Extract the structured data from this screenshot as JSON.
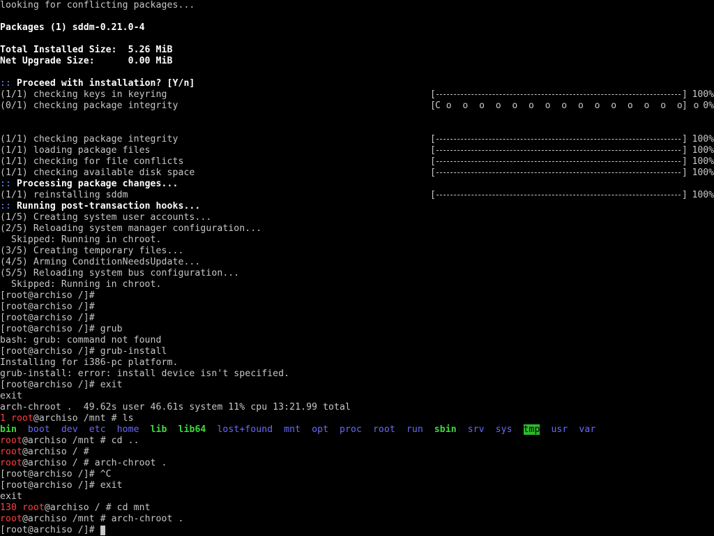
{
  "terminal": {
    "lines": [
      {
        "segments": [
          {
            "text": "looking for conflicting packages...",
            "color": "default"
          }
        ]
      },
      {
        "segments": []
      },
      {
        "segments": [
          {
            "text": "Packages (1) sddm-0.21.0-4",
            "color": "white"
          }
        ]
      },
      {
        "segments": []
      },
      {
        "segments": [
          {
            "text": "Total Installed Size:  5.26 MiB",
            "color": "white"
          }
        ]
      },
      {
        "segments": [
          {
            "text": "Net Upgrade Size:      0.00 MiB",
            "color": "white"
          }
        ]
      },
      {
        "segments": []
      },
      {
        "segments": [
          {
            "text": ":: ",
            "color": "cyan"
          },
          {
            "text": "Proceed with installation? [Y/n]",
            "color": "white"
          }
        ]
      },
      {
        "segments": [
          {
            "text": "(1/1) checking keys in keyring",
            "color": "default"
          }
        ],
        "progress": {
          "percent": 100,
          "percent_label": "100%",
          "style": "dash"
        }
      },
      {
        "segments": [
          {
            "text": "(0/1) checking package integrity",
            "color": "default"
          }
        ],
        "progress": {
          "percent": 0,
          "percent_label": "0%",
          "style": "pacman",
          "pacman_text": "C o  o  o  o  o  o  o  o  o  o  o  o  o  o  o  o"
        }
      },
      {
        "segments": []
      },
      {
        "segments": []
      },
      {
        "segments": [
          {
            "text": "(1/1) checking package integrity",
            "color": "default"
          }
        ],
        "progress": {
          "percent": 100,
          "percent_label": "100%",
          "style": "dash"
        }
      },
      {
        "segments": [
          {
            "text": "(1/1) loading package files",
            "color": "default"
          }
        ],
        "progress": {
          "percent": 100,
          "percent_label": "100%",
          "style": "dash"
        }
      },
      {
        "segments": [
          {
            "text": "(1/1) checking for file conflicts",
            "color": "default"
          }
        ],
        "progress": {
          "percent": 100,
          "percent_label": "100%",
          "style": "dash"
        }
      },
      {
        "segments": [
          {
            "text": "(1/1) checking available disk space",
            "color": "default"
          }
        ],
        "progress": {
          "percent": 100,
          "percent_label": "100%",
          "style": "dash"
        }
      },
      {
        "segments": [
          {
            "text": ":: ",
            "color": "cyan"
          },
          {
            "text": "Processing package changes...",
            "color": "white"
          }
        ]
      },
      {
        "segments": [
          {
            "text": "(1/1) reinstalling sddm",
            "color": "default"
          }
        ],
        "progress": {
          "percent": 100,
          "percent_label": "100%",
          "style": "dash"
        }
      },
      {
        "segments": [
          {
            "text": ":: ",
            "color": "cyan"
          },
          {
            "text": "Running post-transaction hooks...",
            "color": "white"
          }
        ]
      },
      {
        "segments": [
          {
            "text": "(1/5) Creating system user accounts...",
            "color": "default"
          }
        ]
      },
      {
        "segments": [
          {
            "text": "(2/5) Reloading system manager configuration...",
            "color": "default"
          }
        ]
      },
      {
        "segments": [
          {
            "text": "  Skipped: Running in chroot.",
            "color": "default"
          }
        ]
      },
      {
        "segments": [
          {
            "text": "(3/5) Creating temporary files...",
            "color": "default"
          }
        ]
      },
      {
        "segments": [
          {
            "text": "(4/5) Arming ConditionNeedsUpdate...",
            "color": "default"
          }
        ]
      },
      {
        "segments": [
          {
            "text": "(5/5) Reloading system bus configuration...",
            "color": "default"
          }
        ]
      },
      {
        "segments": [
          {
            "text": "  Skipped: Running in chroot.",
            "color": "default"
          }
        ]
      },
      {
        "segments": [
          {
            "text": "[root@archiso /]#",
            "color": "default"
          }
        ]
      },
      {
        "segments": [
          {
            "text": "[root@archiso /]#",
            "color": "default"
          }
        ]
      },
      {
        "segments": [
          {
            "text": "[root@archiso /]#",
            "color": "default"
          }
        ]
      },
      {
        "segments": [
          {
            "text": "[root@archiso /]# grub",
            "color": "default"
          }
        ]
      },
      {
        "segments": [
          {
            "text": "bash: grub: command not found",
            "color": "default"
          }
        ]
      },
      {
        "segments": [
          {
            "text": "[root@archiso /]# grub-install",
            "color": "default"
          }
        ]
      },
      {
        "segments": [
          {
            "text": "Installing for i386-pc platform.",
            "color": "default"
          }
        ]
      },
      {
        "segments": [
          {
            "text": "grub-install: error: install device isn't specified.",
            "color": "default"
          }
        ]
      },
      {
        "segments": [
          {
            "text": "[root@archiso /]# exit",
            "color": "default"
          }
        ]
      },
      {
        "segments": [
          {
            "text": "exit",
            "color": "default"
          }
        ]
      },
      {
        "segments": [
          {
            "text": "arch-chroot .  49.62s user 46.61s system 11% cpu 13:21.99 total",
            "color": "default"
          }
        ]
      },
      {
        "segments": [
          {
            "text": "1 ",
            "color": "red"
          },
          {
            "text": "root",
            "color": "red"
          },
          {
            "text": "@archiso /mnt # ls",
            "color": "default"
          }
        ]
      },
      {
        "segments": [
          {
            "text": "bin",
            "color": "green"
          },
          {
            "text": "  ",
            "color": "default"
          },
          {
            "text": "boot",
            "color": "blue"
          },
          {
            "text": "  ",
            "color": "default"
          },
          {
            "text": "dev",
            "color": "blue"
          },
          {
            "text": "  ",
            "color": "default"
          },
          {
            "text": "etc",
            "color": "blue"
          },
          {
            "text": "  ",
            "color": "default"
          },
          {
            "text": "home",
            "color": "blue"
          },
          {
            "text": "  ",
            "color": "default"
          },
          {
            "text": "lib",
            "color": "green"
          },
          {
            "text": "  ",
            "color": "default"
          },
          {
            "text": "lib64",
            "color": "green"
          },
          {
            "text": "  ",
            "color": "default"
          },
          {
            "text": "lost+found",
            "color": "blue"
          },
          {
            "text": "  ",
            "color": "default"
          },
          {
            "text": "mnt",
            "color": "blue"
          },
          {
            "text": "  ",
            "color": "default"
          },
          {
            "text": "opt",
            "color": "blue"
          },
          {
            "text": "  ",
            "color": "default"
          },
          {
            "text": "proc",
            "color": "blue"
          },
          {
            "text": "  ",
            "color": "default"
          },
          {
            "text": "root",
            "color": "blue"
          },
          {
            "text": "  ",
            "color": "default"
          },
          {
            "text": "run",
            "color": "blue"
          },
          {
            "text": "  ",
            "color": "default"
          },
          {
            "text": "sbin",
            "color": "green"
          },
          {
            "text": "  ",
            "color": "default"
          },
          {
            "text": "srv",
            "color": "blue"
          },
          {
            "text": "  ",
            "color": "default"
          },
          {
            "text": "sys",
            "color": "blue"
          },
          {
            "text": "  ",
            "color": "default"
          },
          {
            "text": "tmp",
            "color": "tmp"
          },
          {
            "text": "  ",
            "color": "default"
          },
          {
            "text": "usr",
            "color": "blue"
          },
          {
            "text": "  ",
            "color": "default"
          },
          {
            "text": "var",
            "color": "blue"
          }
        ]
      },
      {
        "segments": [
          {
            "text": "root",
            "color": "red"
          },
          {
            "text": "@archiso /mnt # cd ..",
            "color": "default"
          }
        ]
      },
      {
        "segments": [
          {
            "text": "root",
            "color": "red"
          },
          {
            "text": "@archiso / #",
            "color": "default"
          }
        ]
      },
      {
        "segments": [
          {
            "text": "root",
            "color": "red"
          },
          {
            "text": "@archiso / # arch-chroot .",
            "color": "default"
          }
        ]
      },
      {
        "segments": [
          {
            "text": "[root@archiso /]# ^C",
            "color": "default"
          }
        ]
      },
      {
        "segments": [
          {
            "text": "[root@archiso /]# exit",
            "color": "default"
          }
        ]
      },
      {
        "segments": [
          {
            "text": "exit",
            "color": "default"
          }
        ]
      },
      {
        "segments": [
          {
            "text": "130 ",
            "color": "red"
          },
          {
            "text": "root",
            "color": "red"
          },
          {
            "text": "@archiso / # cd mnt",
            "color": "default"
          }
        ]
      },
      {
        "segments": [
          {
            "text": "root",
            "color": "red"
          },
          {
            "text": "@archiso /mnt # arch-chroot .",
            "color": "default"
          }
        ]
      },
      {
        "segments": [
          {
            "text": "[root@archiso /]#",
            "color": "default"
          }
        ],
        "cursor": true
      }
    ]
  },
  "colors": {
    "background": "#000000",
    "default": "#c8c8c8",
    "white": "#ffffff",
    "cyan": "#5a9bff",
    "red": "#ff4040",
    "blue": "#6a6aff",
    "green": "#3ddc3d",
    "tmp_bg": "#2fb82f"
  }
}
